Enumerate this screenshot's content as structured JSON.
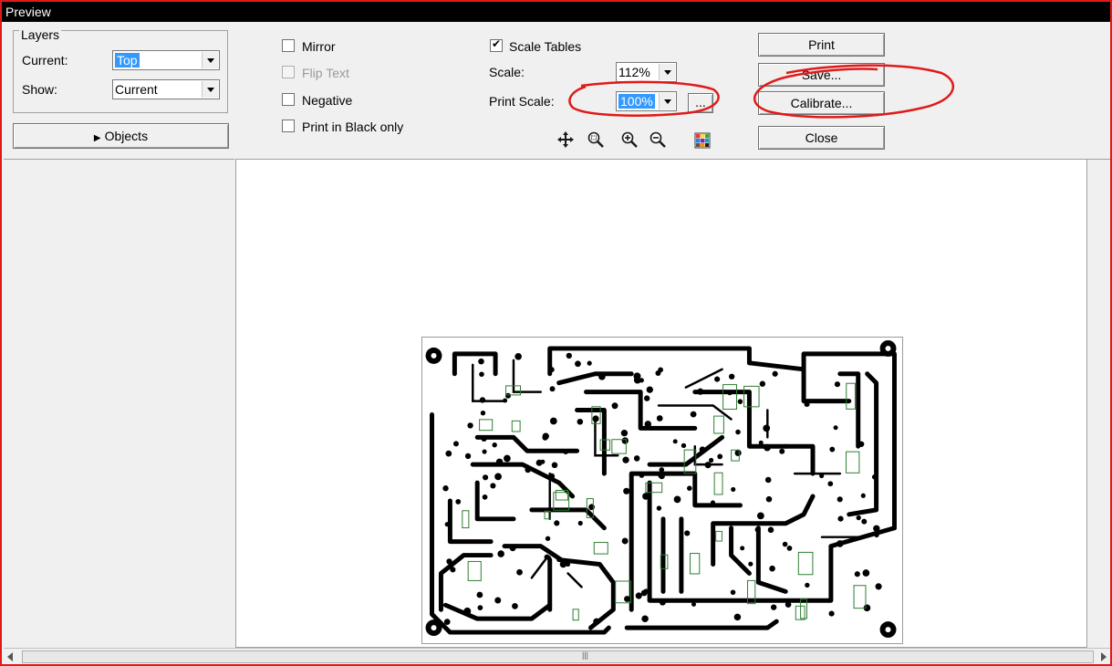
{
  "window": {
    "title": "Preview"
  },
  "layers": {
    "group_label": "Layers",
    "current_label": "Current:",
    "current_value": "Top",
    "show_label": "Show:",
    "show_value": "Current"
  },
  "objects_button": {
    "label": "Objects",
    "icon": "triangle-right-icon"
  },
  "options": {
    "mirror": {
      "label": "Mirror",
      "checked": false,
      "enabled": true
    },
    "flip_text": {
      "label": "Flip Text",
      "checked": false,
      "enabled": false
    },
    "negative": {
      "label": "Negative",
      "checked": false,
      "enabled": true
    },
    "black_only": {
      "label": "Print in Black only",
      "checked": false,
      "enabled": true
    }
  },
  "scaling": {
    "scale_tables": {
      "label": "Scale Tables",
      "checked": true
    },
    "scale_label": "Scale:",
    "scale_value": "112%",
    "print_scale_label": "Print Scale:",
    "print_scale_value": "100%",
    "ellipsis_button": "..."
  },
  "toolbar": {
    "icons": [
      "move-icon",
      "zoom-area-icon",
      "zoom-in-icon",
      "zoom-out-icon",
      "color-palette-icon"
    ]
  },
  "actions": {
    "print": "Print",
    "save": "Save...",
    "calibrate": "Calibrate...",
    "close": "Close"
  },
  "colors": {
    "annotation_red": "#e01a1a",
    "selection_blue": "#3399ff",
    "trace_black": "#000000",
    "component_green": "#2e7d32"
  },
  "scrollbar": {
    "grip": "|||"
  }
}
